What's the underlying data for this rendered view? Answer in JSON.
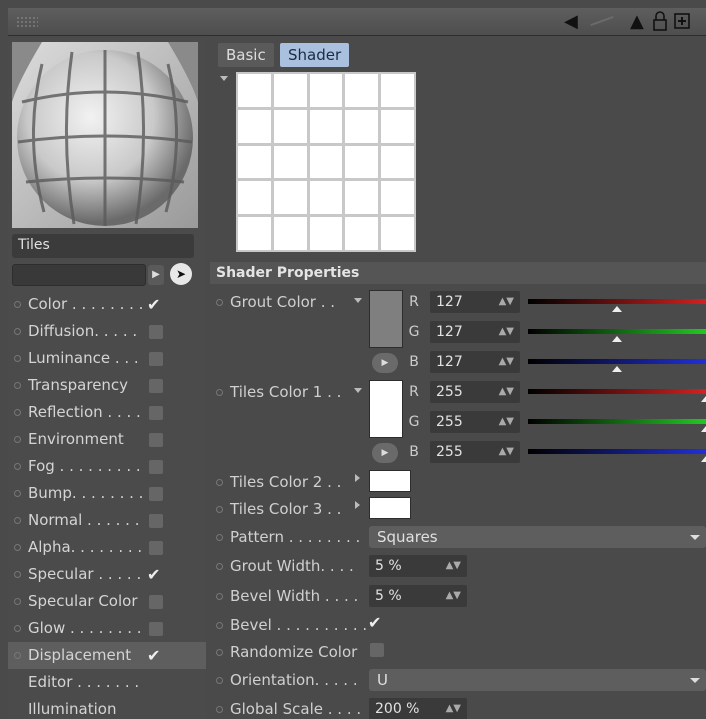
{
  "toolbar": {
    "back_icon": "arrow-left-icon",
    "up_icon": "arrow-up-icon",
    "lock_icon": "lock-icon",
    "add_icon": "plus-box-icon"
  },
  "material": {
    "name": "Tiles"
  },
  "channels": [
    {
      "label": "Color . . . . . . . .",
      "checked": true
    },
    {
      "label": "Diffusion. . . . .",
      "checked": false
    },
    {
      "label": "Luminance  . . .",
      "checked": false
    },
    {
      "label": "Transparency",
      "checked": false
    },
    {
      "label": "Reflection . . . .",
      "checked": false
    },
    {
      "label": "Environment",
      "checked": false
    },
    {
      "label": "Fog . . . . . . . . .",
      "checked": false
    },
    {
      "label": "Bump. . . . . . . .",
      "checked": false
    },
    {
      "label": "Normal  . . . . . .",
      "checked": false
    },
    {
      "label": "Alpha. . . . . . . .",
      "checked": false
    },
    {
      "label": "Specular . . . . .",
      "checked": true
    },
    {
      "label": "Specular Color",
      "checked": false
    },
    {
      "label": "Glow . . . . . . . .",
      "checked": false
    },
    {
      "label": "Displacement",
      "checked": true
    },
    {
      "label": "Editor  . . . . . . .",
      "checked": null
    },
    {
      "label": "Illumination",
      "checked": null
    }
  ],
  "tabs": {
    "basic": "Basic",
    "shader": "Shader"
  },
  "section_title": "Shader Properties",
  "grout_color": {
    "label": "Grout Color  . .",
    "swatch": "#7f7f7f",
    "r_label": "R",
    "g_label": "G",
    "b_label": "B",
    "r": "127",
    "g": "127",
    "b": "127",
    "r_level": 0.498,
    "g_level": 0.498,
    "b_level": 0.498
  },
  "tiles_color_1": {
    "label": "Tiles Color 1 . .",
    "swatch": "#ffffff",
    "r_label": "R",
    "g_label": "G",
    "b_label": "B",
    "r": "255",
    "g": "255",
    "b": "255",
    "r_level": 1.0,
    "g_level": 1.0,
    "b_level": 1.0
  },
  "tiles_color_2": {
    "label": "Tiles Color 2 . .",
    "swatch": "#ffffff"
  },
  "tiles_color_3": {
    "label": "Tiles Color 3 . .",
    "swatch": "#ffffff"
  },
  "pattern": {
    "label": "Pattern . . . . . . . .",
    "value": "Squares"
  },
  "grout_width": {
    "label": "Grout Width. . . .",
    "value": "5 %"
  },
  "bevel_width": {
    "label": "Bevel Width . . . .",
    "value": "5 %"
  },
  "bevel": {
    "label": "Bevel . . . . . . . . . .",
    "checked": true
  },
  "randomize_color": {
    "label": "Randomize Color",
    "checked": false
  },
  "orientation": {
    "label": "Orientation. . . . .",
    "value": "U"
  },
  "global_scale": {
    "label": "Global Scale . . . .",
    "value": "200 %"
  },
  "colors": {
    "tab_active": "#a9c1de",
    "red": "#d42020",
    "green": "#22c822",
    "blue": "#2030d8"
  }
}
